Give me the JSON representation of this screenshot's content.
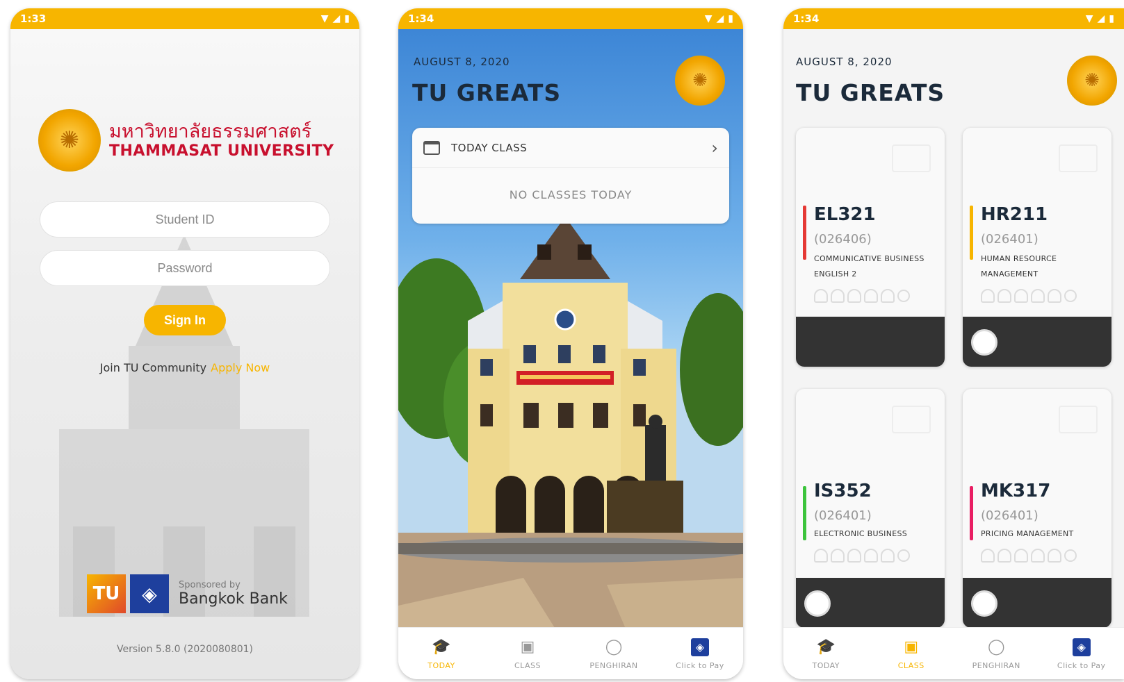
{
  "phone1": {
    "status_time": "1:33",
    "university_thai": "มหาวิทยาลัยธรรมศาสตร์",
    "university_en": "THAMMASAT UNIVERSITY",
    "student_id_placeholder": "Student ID",
    "password_placeholder": "Password",
    "signin_label": "Sign In",
    "join_text": "Join TU Community",
    "apply_text": "Apply Now",
    "tu_badge": "TU",
    "sponsored_by": "Sponsored by",
    "bank_name": "Bangkok Bank",
    "version": "Version 5.8.0 (2020080801)"
  },
  "phone2": {
    "status_time": "1:34",
    "date": "AUGUST 8, 2020",
    "title": "TU GREATS",
    "today_class_label": "TODAY CLASS",
    "no_classes": "NO CLASSES TODAY"
  },
  "phone3": {
    "status_time": "1:34",
    "date": "AUGUST 8, 2020",
    "title": "TU GREATS",
    "courses": [
      {
        "code": "EL321",
        "section": "(026406)",
        "name": "COMMUNICATIVE BUSINESS ENGLISH 2",
        "color": "#e53935"
      },
      {
        "code": "HR211",
        "section": "(026401)",
        "name": "HUMAN RESOURCE MANAGEMENT",
        "color": "#f7b500"
      },
      {
        "code": "IS352",
        "section": "(026401)",
        "name": "ELECTRONIC BUSINESS",
        "color": "#3cc43c"
      },
      {
        "code": "MK317",
        "section": "(026401)",
        "name": "PRICING MANAGEMENT",
        "color": "#e91e63"
      }
    ]
  },
  "nav": {
    "today": "TODAY",
    "class": "CLASS",
    "pengkiran": "PENGHIRAN",
    "pay": "Click to Pay"
  },
  "icons": {
    "status": [
      "wifi-icon",
      "signal-icon",
      "battery-icon"
    ],
    "nav": [
      "graduation-cap-icon",
      "presentation-icon",
      "person-icon",
      "bangkok-bank-icon"
    ]
  },
  "colors": {
    "accent": "#f7b500",
    "brand_red": "#c8102e",
    "bank_blue": "#1e3f9d",
    "card_footer": "#333333"
  }
}
